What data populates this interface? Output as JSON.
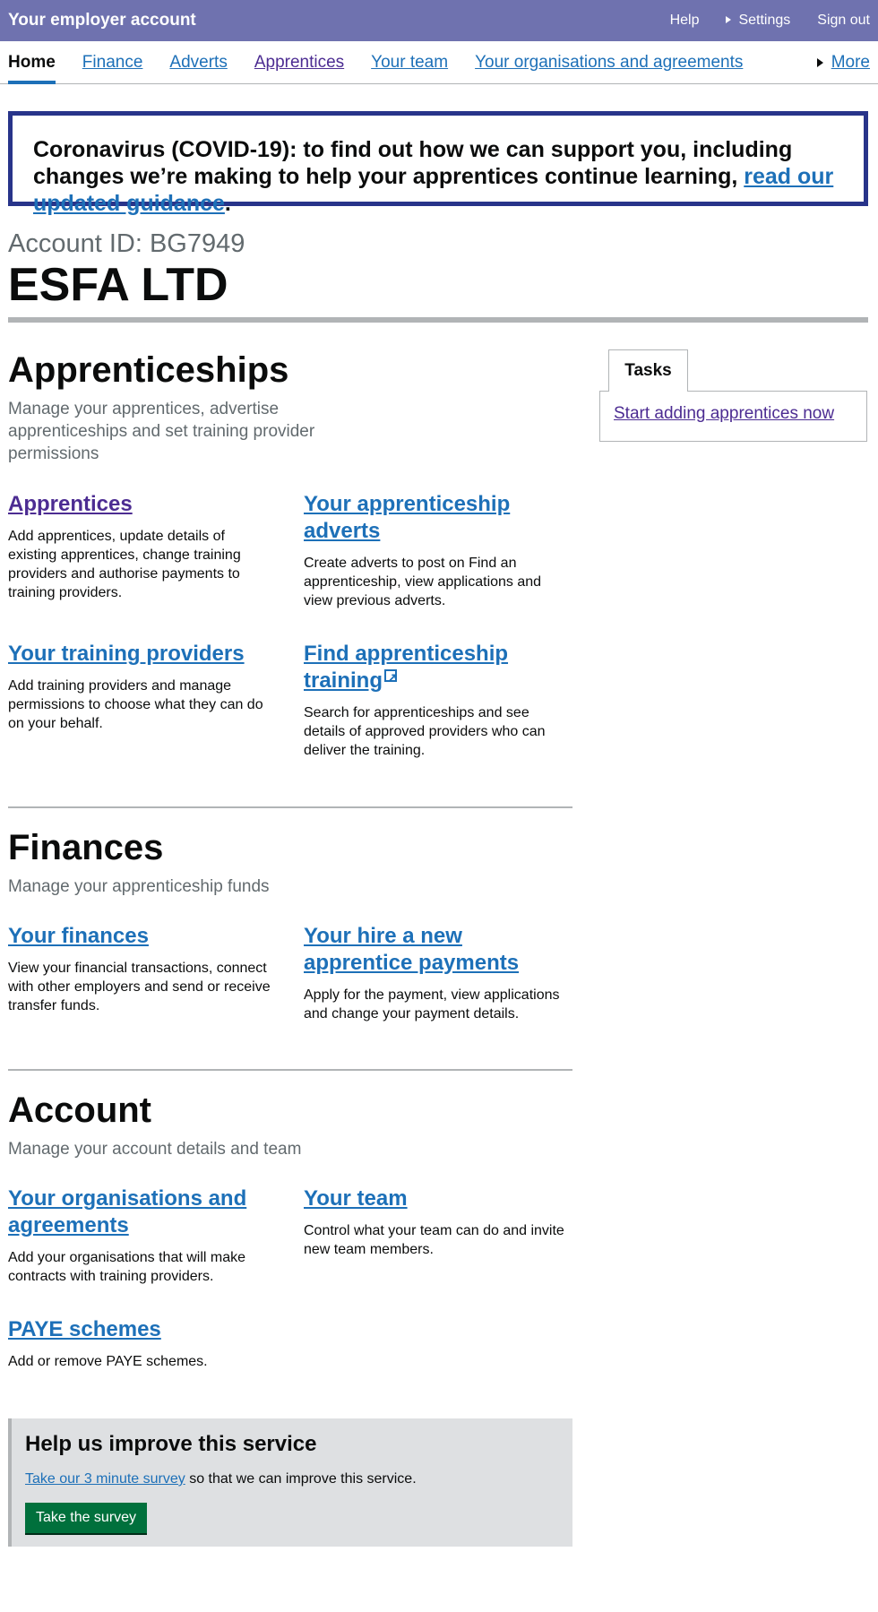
{
  "header": {
    "title": "Your employer account",
    "help": "Help",
    "settings": "Settings",
    "sign_out": "Sign out",
    "background_color": "#6f72af"
  },
  "nav": {
    "items": [
      {
        "label": "Home"
      },
      {
        "label": "Finance"
      },
      {
        "label": "Adverts"
      },
      {
        "label": "Apprentices"
      },
      {
        "label": "Your team"
      },
      {
        "label": "Your organisations and agreements"
      }
    ],
    "more": "More",
    "active": "Home"
  },
  "banner": {
    "text": "Coronavirus (COVID-19): to find out how we can support you, including changes we’re making to help your apprentices continue learning, ",
    "link": "read our updated guidance",
    "suffix": ".",
    "border_color": "#28348a"
  },
  "account": {
    "id_label": "Account ID: BG7949",
    "name": "ESFA LTD"
  },
  "apprenticeships": {
    "title": "Apprenticeships",
    "caption": "Manage your apprentices, advertise apprenticeships and set training provider permissions",
    "cards": [
      {
        "title": "Apprentices",
        "desc": "Add apprentices, update details of existing apprentices, change training providers and authorise payments to training providers."
      },
      {
        "title": "Your apprenticeship adverts",
        "desc": "Create adverts to post on Find an apprenticeship, view applications and view previous adverts."
      },
      {
        "title": "Your training providers",
        "desc": "Add training providers and manage permissions to choose what they can do on your behalf."
      },
      {
        "title": "Find apprenticeship training",
        "desc": "Search for apprenticeships and see details of approved providers who can deliver the training."
      }
    ]
  },
  "finances": {
    "title": "Finances",
    "caption": "Manage your apprenticeship funds",
    "cards": [
      {
        "title": "Your finances",
        "desc": "View your financial transactions, connect with other employers and send or receive transfer funds."
      },
      {
        "title": "Your hire a new apprentice payments",
        "desc": "Apply for the payment, view applications and change your payment details."
      }
    ]
  },
  "account_section": {
    "title": "Account",
    "caption": "Manage your account details and team",
    "cards": [
      {
        "title": "Your organisations and agreements",
        "desc": "Add your organisations that will make contracts with training providers."
      },
      {
        "title": "Your team",
        "desc": "Control what your team can do and invite new team members."
      },
      {
        "title": "PAYE schemes",
        "desc": "Add or remove PAYE schemes."
      }
    ]
  },
  "tasks": {
    "tab": "Tasks",
    "link": "Start adding apprentices now"
  },
  "survey": {
    "title": "Help us improve this service",
    "link": "Take our 3 minute survey",
    "text": " so that we can improve this service.",
    "button": "Take the survey",
    "button_color": "#00703c"
  }
}
